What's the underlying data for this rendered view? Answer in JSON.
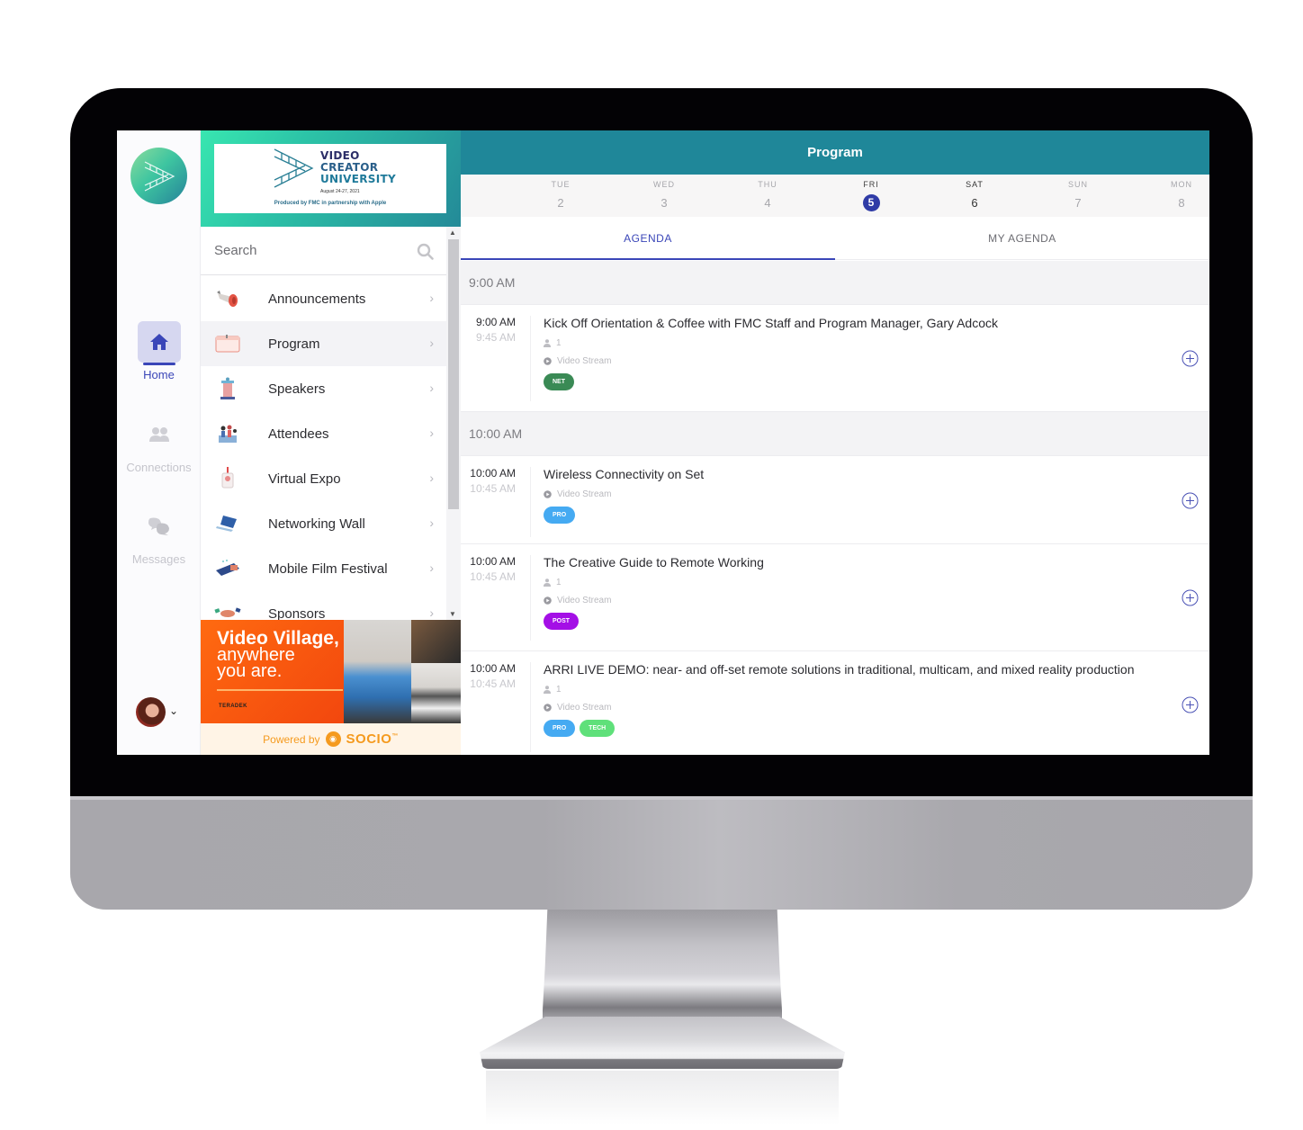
{
  "app": {
    "event_logo_lines": [
      "VIDEO",
      "CREATOR",
      "UNIVERSITY"
    ],
    "event_date": "August 24-27, 2021",
    "event_produced_by": "Produced by FMC in partnership with Apple"
  },
  "rail": {
    "items": [
      {
        "label": "Home",
        "icon": "home-icon",
        "active": true
      },
      {
        "label": "Connections",
        "icon": "people-icon",
        "active": false
      },
      {
        "label": "Messages",
        "icon": "chat-icon",
        "active": false
      }
    ],
    "avatar_caret": "⌄"
  },
  "menu": {
    "search_placeholder": "Search",
    "items": [
      {
        "label": "Announcements",
        "icon": "megaphone-icon"
      },
      {
        "label": "Program",
        "icon": "calendar-icon",
        "selected": true
      },
      {
        "label": "Speakers",
        "icon": "podium-icon"
      },
      {
        "label": "Attendees",
        "icon": "attendees-icon"
      },
      {
        "label": "Virtual Expo",
        "icon": "badge-icon"
      },
      {
        "label": "Networking Wall",
        "icon": "laptop-icon"
      },
      {
        "label": "Mobile Film Festival",
        "icon": "film-icon"
      },
      {
        "label": "Sponsors",
        "icon": "handshake-icon"
      }
    ],
    "chevron": "›"
  },
  "ad": {
    "headline_1": "Video Village,",
    "headline_2": "anywhere",
    "headline_3": "you are.",
    "brand": "TERADEK"
  },
  "footer": {
    "powered_by": "Powered by",
    "brand": "SOCIO",
    "trademark": "™"
  },
  "main": {
    "title": "Program",
    "days": [
      {
        "name": "TUE",
        "date": "2",
        "state": "muted"
      },
      {
        "name": "WED",
        "date": "3",
        "state": "muted"
      },
      {
        "name": "THU",
        "date": "4",
        "state": "muted"
      },
      {
        "name": "FRI",
        "date": "5",
        "state": "active"
      },
      {
        "name": "SAT",
        "date": "6",
        "state": "dark"
      },
      {
        "name": "SUN",
        "date": "7",
        "state": "muted"
      },
      {
        "name": "MON",
        "date": "8",
        "state": "muted"
      }
    ],
    "tabs": [
      {
        "label": "AGENDA",
        "active": true
      },
      {
        "label": "MY AGENDA",
        "active": false
      }
    ],
    "slots": [
      {
        "header": "9:00 AM",
        "sessions": [
          {
            "start": "9:00 AM",
            "end": "9:45 AM",
            "title": "Kick Off Orientation & Coffee with FMC Staff and Program Manager, Gary Adcock",
            "speakers": "1",
            "stream": "Video Stream",
            "tags": [
              {
                "label": "NET",
                "color": "#3a8a55"
              }
            ]
          }
        ]
      },
      {
        "header": "10:00 AM",
        "sessions": [
          {
            "start": "10:00 AM",
            "end": "10:45 AM",
            "title": "Wireless Connectivity on Set",
            "speakers": null,
            "stream": "Video Stream",
            "tags": [
              {
                "label": "PRO",
                "color": "#45aaf2"
              }
            ]
          },
          {
            "start": "10:00 AM",
            "end": "10:45 AM",
            "title": "The Creative Guide to Remote Working",
            "speakers": "1",
            "stream": "Video Stream",
            "tags": [
              {
                "label": "POST",
                "color": "#a40fe6"
              }
            ]
          },
          {
            "start": "10:00 AM",
            "end": "10:45 AM",
            "title": "ARRI LIVE DEMO: near- and off-set remote solutions in traditional, multicam, and mixed reality production",
            "speakers": "1",
            "stream": "Video Stream",
            "tags": [
              {
                "label": "PRO",
                "color": "#45aaf2"
              },
              {
                "label": "TECH",
                "color": "#5fe07a"
              }
            ]
          }
        ]
      }
    ]
  },
  "colors": {
    "accent": "#3a46b8",
    "topbar": "#1f8799",
    "brand_orange": "#f59a1e"
  }
}
